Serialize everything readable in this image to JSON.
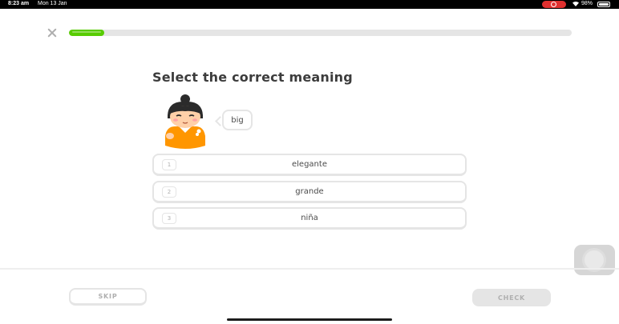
{
  "status_bar": {
    "time": "8:23 am",
    "date": "Mon 13 Jan",
    "battery_percent": "98%",
    "battery_level": 0.98,
    "icons": [
      "screen-record-icon",
      "wifi-icon",
      "battery-icon"
    ]
  },
  "header": {
    "close_icon": "close-icon",
    "progress": 0.07
  },
  "lesson": {
    "title": "Select the correct meaning",
    "prompt_word": "big",
    "character_icon": "character-illustration",
    "options": [
      {
        "number": "1",
        "label": "elegante"
      },
      {
        "number": "2",
        "label": "grande"
      },
      {
        "number": "3",
        "label": "niña"
      }
    ]
  },
  "footer": {
    "skip_label": "SKIP",
    "check_label": "CHECK"
  },
  "colors": {
    "progress": "#58cc02",
    "track": "#e5e5e5",
    "text": "#4b4b4b",
    "muted": "#afafaf",
    "character_shirt": "#ff9600"
  }
}
